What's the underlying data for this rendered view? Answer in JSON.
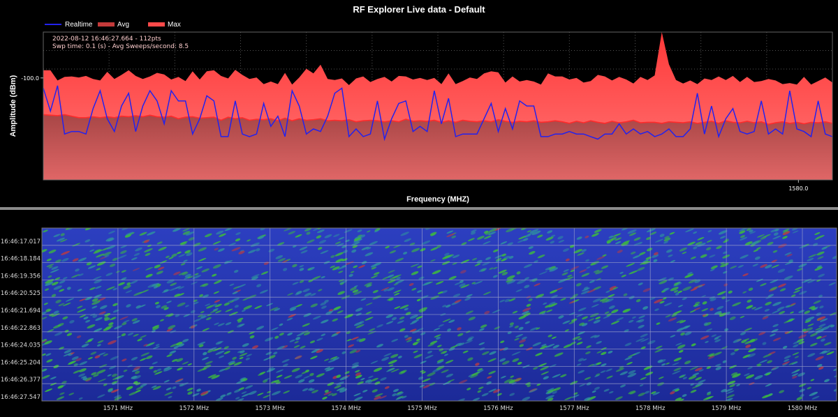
{
  "colors": {
    "realtime": "#2222ee",
    "avg": "#c43a3a",
    "max": "#ff4a4a",
    "grid": "#555555",
    "waterfall_bg": "#1a2c9c",
    "waterfall_hot": "#3dbb3d"
  },
  "chart_data": {
    "type": "area",
    "title": "RF Explorer Live data - Default",
    "xlabel": "Frequency (MHZ)",
    "ylabel": "Amplitude (dBm)",
    "info_line1": "2022-08-12 16:46:27.664 - 112pts",
    "info_line2": "Swp time: 0.1 (s) - Avg Sweeps/second: 8.5",
    "x_tick_labels": [
      {
        "x": 1580.0,
        "label": "1580.0"
      }
    ],
    "y_tick_labels": [
      {
        "y": -100.0,
        "label": "-100.0"
      }
    ],
    "xlim": [
      1570.0,
      1580.45
    ],
    "ylim": [
      -120.0,
      -91.0
    ],
    "grid": true,
    "legend_position": "top-left",
    "legend": [
      "Realtime",
      "Avg",
      "Max"
    ],
    "series": [
      {
        "name": "Max",
        "style": "filled-area",
        "values": [
          -98.5,
          -98.5,
          -100.5,
          -99.8,
          -99.7,
          -99.9,
          -99.6,
          -100.2,
          -100.5,
          -98.8,
          -100.2,
          -99.4,
          -98.5,
          -99.6,
          -100.2,
          -99.7,
          -99.0,
          -99.3,
          -100.3,
          -99.8,
          -100.6,
          -98.7,
          -100.3,
          -98.7,
          -98.5,
          -99.6,
          -100.1,
          -98.4,
          -99.4,
          -100.2,
          -99.9,
          -101.2,
          -100.7,
          -101.2,
          -99.0,
          -101.3,
          -99.9,
          -98.2,
          -99.1,
          -97.4,
          -100.2,
          -100.4,
          -100.1,
          -101.4,
          -100.1,
          -99.7,
          -100.8,
          -100.2,
          -99.8,
          -100.7,
          -99.6,
          -99.7,
          -100.3,
          -100.0,
          -100.4,
          -100.0,
          -101.2,
          -99.1,
          -101.2,
          -100.6,
          -99.9,
          -100.2,
          -99.1,
          -98.7,
          -98.9,
          -100.9,
          -99.7,
          -100.7,
          -100.4,
          -100.7,
          -101.3,
          -99.1,
          -99.7,
          -99.7,
          -100.3,
          -100.0,
          -100.9,
          -100.6,
          -99.4,
          -99.7,
          -100.5,
          -99.8,
          -100.3,
          -101.1,
          -99.8,
          -100.4,
          -99.5,
          -91.0,
          -97.3,
          -100.4,
          -101.1,
          -100.5,
          -101.2,
          -100.1,
          -100.4,
          -99.7,
          -100.4,
          -99.6,
          -100.8,
          -99.8,
          -100.8,
          -100.6,
          -100.2,
          -100.5,
          -101.2,
          -101.0,
          -101.3,
          -99.8,
          -101.3,
          -100.6,
          -99.9,
          -100.9
        ]
      },
      {
        "name": "Avg",
        "style": "filled-area",
        "values": [
          -107.2,
          -107.3,
          -107.4,
          -107.2,
          -107.5,
          -107.8,
          -107.8,
          -107.6,
          -107.8,
          -107.6,
          -107.8,
          -107.5,
          -107.6,
          -107.4,
          -107.6,
          -107.3,
          -107.6,
          -107.7,
          -107.5,
          -108.0,
          -107.7,
          -107.6,
          -107.9,
          -107.8,
          -107.7,
          -108.3,
          -107.7,
          -108.0,
          -107.8,
          -108.3,
          -108.1,
          -108.2,
          -108.0,
          -108.4,
          -107.9,
          -108.4,
          -108.0,
          -108.3,
          -108.2,
          -108.0,
          -108.4,
          -108.3,
          -108.4,
          -108.2,
          -108.6,
          -108.4,
          -108.3,
          -108.4,
          -108.6,
          -108.4,
          -108.6,
          -108.1,
          -108.5,
          -108.4,
          -108.5,
          -108.3,
          -108.7,
          -108.4,
          -108.7,
          -108.3,
          -108.5,
          -108.6,
          -108.4,
          -108.6,
          -108.2,
          -108.5,
          -108.7,
          -108.5,
          -108.6,
          -108.4,
          -108.7,
          -108.6,
          -108.4,
          -108.6,
          -108.9,
          -108.5,
          -108.8,
          -108.4,
          -108.7,
          -108.9,
          -108.5,
          -108.8,
          -108.6,
          -108.3,
          -108.8,
          -108.7,
          -108.7,
          -108.9,
          -108.6,
          -108.7,
          -108.8,
          -108.6,
          -108.9,
          -108.7,
          -108.5,
          -108.9,
          -108.4,
          -108.7,
          -108.8,
          -108.5,
          -108.8,
          -108.6,
          -109.1,
          -108.8,
          -108.6,
          -108.9,
          -108.7,
          -109.0,
          -108.7,
          -108.8,
          -108.6,
          -108.9
        ]
      },
      {
        "name": "Realtime",
        "style": "line",
        "values": [
          -102.0,
          -106.5,
          -101.5,
          -111.0,
          -110.5,
          -110.5,
          -111.0,
          -106.0,
          -102.5,
          -108.0,
          -110.5,
          -105.5,
          -103.0,
          -110.5,
          -105.5,
          -102.5,
          -104.5,
          -109.0,
          -102.5,
          -104.5,
          -104.5,
          -111.0,
          -108.0,
          -103.5,
          -104.5,
          -111.5,
          -111.5,
          -104.5,
          -111.0,
          -111.5,
          -111.0,
          -105.0,
          -109.5,
          -107.5,
          -111.5,
          -102.5,
          -105.5,
          -111.0,
          -110.0,
          -110.5,
          -107.5,
          -103.0,
          -102.0,
          -111.5,
          -110.0,
          -111.5,
          -111.0,
          -104.5,
          -112.0,
          -108.0,
          -105.0,
          -104.5,
          -110.5,
          -109.5,
          -110.5,
          -102.5,
          -109.0,
          -104.0,
          -111.5,
          -111.0,
          -111.0,
          -111.0,
          -108.0,
          -105.0,
          -110.5,
          -106.0,
          -110.0,
          -104.5,
          -105.5,
          -105.5,
          -111.5,
          -111.5,
          -111.0,
          -111.0,
          -110.5,
          -111.0,
          -111.0,
          -111.5,
          -112.0,
          -111.0,
          -111.0,
          -109.0,
          -111.0,
          -110.0,
          -111.0,
          -110.5,
          -111.5,
          -111.0,
          -110.0,
          -111.5,
          -111.5,
          -110.0,
          -103.0,
          -111.0,
          -105.5,
          -111.5,
          -108.0,
          -106.0,
          -110.5,
          -111.0,
          -110.5,
          -104.5,
          -111.0,
          -110.0,
          -111.0,
          -102.5,
          -110.0,
          -110.5,
          -111.5,
          -104.5,
          -111.0,
          -111.5
        ]
      }
    ]
  },
  "waterfall": {
    "time_labels": [
      "16:46:17.017",
      "16:46:18.184",
      "16:46:19.356",
      "16:46:20.525",
      "16:46:21.694",
      "16:46:22.863",
      "16:46:24.035",
      "16:46:25.204",
      "16:46:26.377",
      "16:46:27.547"
    ],
    "freq_labels": [
      "1571 MHz",
      "1572 MHz",
      "1573 MHz",
      "1574 MHz",
      "1575 MHz",
      "1576 MHz",
      "1577 MHz",
      "1578 MHz",
      "1579 MHz",
      "1580 MHz"
    ],
    "freq_values": [
      1571,
      1572,
      1573,
      1574,
      1575,
      1576,
      1577,
      1578,
      1579,
      1580
    ],
    "freq_range": [
      1570.0,
      1580.45
    ]
  }
}
